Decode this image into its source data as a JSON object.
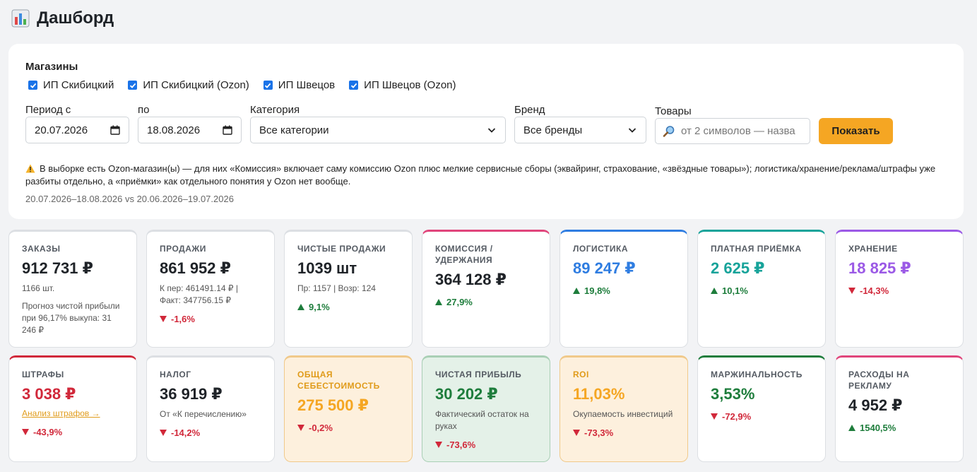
{
  "header": {
    "title": "Дашборд",
    "icon": "bar-chart-icon"
  },
  "filters": {
    "stores_label": "Магазины",
    "stores": [
      {
        "label": "ИП Скибицкий",
        "checked": true
      },
      {
        "label": "ИП Скибицкий (Ozon)",
        "checked": true
      },
      {
        "label": "ИП Швецов",
        "checked": true
      },
      {
        "label": "ИП Швецов (Ozon)",
        "checked": true
      }
    ],
    "period_from_label": "Период с",
    "period_from_value": "20.07.2026",
    "period_to_label": "по",
    "period_to_value": "18.08.2026",
    "category_label": "Категория",
    "category_value": "Все категории",
    "brand_label": "Бренд",
    "brand_value": "Все бренды",
    "products_label": "Товары",
    "products_placeholder": "от 2 символов — назва",
    "show_button": "Показать",
    "warning": "В выборке есть Ozon-магазин(ы) — для них «Комиссия» включает саму комиссию Ozon плюс мелкие сервисные сборы (эквайринг, страхование, «звёздные товары»); логистика/хранение/реклама/штрафы уже разбиты отдельно, а «приёмки» как отдельного понятия у Ozon нет вообще.",
    "comparison": "20.07.2026–18.08.2026 vs 20.06.2026–19.07.2026"
  },
  "colors": {
    "up": "#1e7d3c",
    "down": "#d1283a",
    "accent_blue": "#2f7de1",
    "teal": "#17a39a",
    "purple": "#9b59e6",
    "pink": "#e0457b",
    "red": "#d1283a",
    "orange": "#f5a623"
  },
  "cards_row1": [
    {
      "label": "ЗАКАЗЫ",
      "value": "912 731 ₽",
      "sub": "1166 шт.",
      "sub2": "Прогноз чистой прибыли при 96,17% выкупа: 31 246 ₽"
    },
    {
      "label": "ПРОДАЖИ",
      "value": "861 952 ₽",
      "sub": "К пер: 461491.14 ₽ | Факт: 347756.15 ₽",
      "delta": "-1,6%",
      "dir": "down"
    },
    {
      "label": "ЧИСТЫЕ ПРОДАЖИ",
      "value": "1039 шт",
      "sub": "Пр: 1157 | Возр: 124",
      "delta": "9,1%",
      "dir": "up"
    },
    {
      "label": "КОМИССИЯ / УДЕРЖАНИЯ",
      "value": "364 128 ₽",
      "delta": "27,9%",
      "dir": "up"
    },
    {
      "label": "ЛОГИСТИКА",
      "value": "89 247 ₽",
      "delta": "19,8%",
      "dir": "up"
    },
    {
      "label": "ПЛАТНАЯ ПРИЁМКА",
      "value": "2 625 ₽",
      "delta": "10,1%",
      "dir": "up"
    },
    {
      "label": "ХРАНЕНИЕ",
      "value": "18 825 ₽",
      "delta": "-14,3%",
      "dir": "down"
    }
  ],
  "cards_row2": [
    {
      "label": "ШТРАФЫ",
      "value": "3 038 ₽",
      "link": "Анализ штрафов →",
      "delta": "-43,9%",
      "dir": "down"
    },
    {
      "label": "НАЛОГ",
      "value": "36 919 ₽",
      "sub": "От «К перечислению»",
      "delta": "-14,2%",
      "dir": "down"
    },
    {
      "label": "ОБЩАЯ СЕБЕСТОИМОСТЬ",
      "value": "275 500 ₽",
      "delta": "-0,2%",
      "dir": "down"
    },
    {
      "label": "ЧИСТАЯ ПРИБЫЛЬ",
      "value": "30 202 ₽",
      "sub": "Фактический остаток на руках",
      "delta": "-73,6%",
      "dir": "down"
    },
    {
      "label": "ROI",
      "value": "11,03%",
      "sub": "Окупаемость инвестиций",
      "delta": "-73,3%",
      "dir": "down"
    },
    {
      "label": "МАРЖИНАЛЬНОСТЬ",
      "value": "3,53%",
      "delta": "-72,9%",
      "dir": "down"
    },
    {
      "label": "РАСХОДЫ НА РЕКЛАМУ",
      "value": "4 952 ₽",
      "delta": "1540,5%",
      "dir": "up"
    }
  ]
}
